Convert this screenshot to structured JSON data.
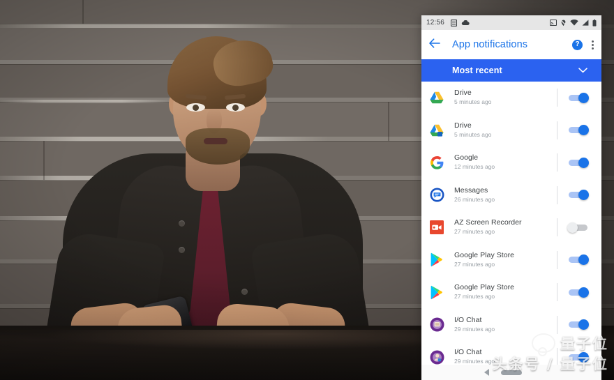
{
  "scene": {
    "description": "video-still-man-at-table-with-phone"
  },
  "phone": {
    "statusbar": {
      "time": "12:56",
      "left_icons": [
        "calendar-notification-icon",
        "cloud-icon"
      ],
      "right_icons": [
        "cast-icon",
        "location-off-icon",
        "wifi-icon",
        "signal-icon",
        "battery-icon"
      ]
    },
    "appbar": {
      "back_icon": "back-arrow-icon",
      "title": "App notifications",
      "help_label": "?",
      "overflow_icon": "overflow-menu-icon"
    },
    "sortbar": {
      "label": "Most recent",
      "chevron_icon": "chevron-down-icon",
      "color": "#2b62f0"
    },
    "notifications": [
      {
        "app": "Drive",
        "time": "5 minutes ago",
        "icon": "google-drive-icon",
        "enabled": true
      },
      {
        "app": "Drive",
        "time": "5 minutes ago",
        "icon": "google-drive-badge-icon",
        "enabled": true
      },
      {
        "app": "Google",
        "time": "12 minutes ago",
        "icon": "google-g-icon",
        "enabled": true
      },
      {
        "app": "Messages",
        "time": "26 minutes ago",
        "icon": "messages-icon",
        "enabled": true
      },
      {
        "app": "AZ Screen Recorder",
        "time": "27 minutes ago",
        "icon": "az-screen-recorder-icon",
        "enabled": false
      },
      {
        "app": "Google Play Store",
        "time": "27 minutes ago",
        "icon": "play-store-icon",
        "enabled": true
      },
      {
        "app": "Google Play Store",
        "time": "27 minutes ago",
        "icon": "play-store-icon",
        "enabled": true
      },
      {
        "app": "I/O Chat",
        "time": "29 minutes ago",
        "icon": "io-chat-avatar-icon",
        "enabled": true
      },
      {
        "app": "I/O Chat",
        "time": "29 minutes ago",
        "icon": "io-chat-avatar-2-icon",
        "enabled": true
      }
    ],
    "navbar": {
      "back_icon": "nav-back-triangle-icon",
      "home_icon": "nav-home-pill-icon"
    }
  },
  "watermark": {
    "line1": "量子位",
    "line2": "头条号 / 量子位",
    "logo_icon": "wechat-logo-icon"
  },
  "colors": {
    "accent_blue": "#1a73e8",
    "sortbar_blue": "#2b62f0",
    "toggle_on_track": "#aac4f5",
    "toggle_off": "#c6c8cc",
    "secondary_text": "#9aa0a6",
    "primary_text": "#3c4043"
  }
}
